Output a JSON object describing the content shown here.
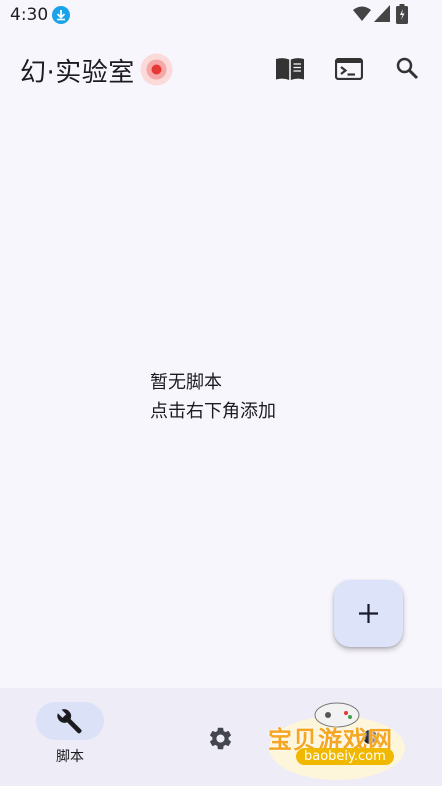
{
  "status_bar": {
    "time": "4:30",
    "icons": [
      "download-icon",
      "wifi-icon",
      "signal-icon",
      "battery-icon"
    ]
  },
  "app_bar": {
    "title": "幻·实验室",
    "actions": [
      "book-icon",
      "terminal-icon",
      "search-icon"
    ],
    "record_color": "#e53935"
  },
  "empty_state": {
    "line1": "暂无脚本",
    "line2": "点击右下角添加"
  },
  "fab": {
    "icon": "plus-icon"
  },
  "bottom_nav": {
    "items": [
      {
        "label": "脚本",
        "icon": "wrench-icon",
        "selected": true
      },
      {
        "label": "",
        "icon": "gear-icon",
        "selected": false
      }
    ]
  },
  "watermark": {
    "text": "宝贝游戏网",
    "url": "baobeiy.com"
  },
  "colors": {
    "background": "#f8f6fd",
    "fab": "#dde3f8",
    "nav_bg": "#eeecf6",
    "nav_pill": "#dbe1f7",
    "accent_download": "#1aa3e8"
  }
}
